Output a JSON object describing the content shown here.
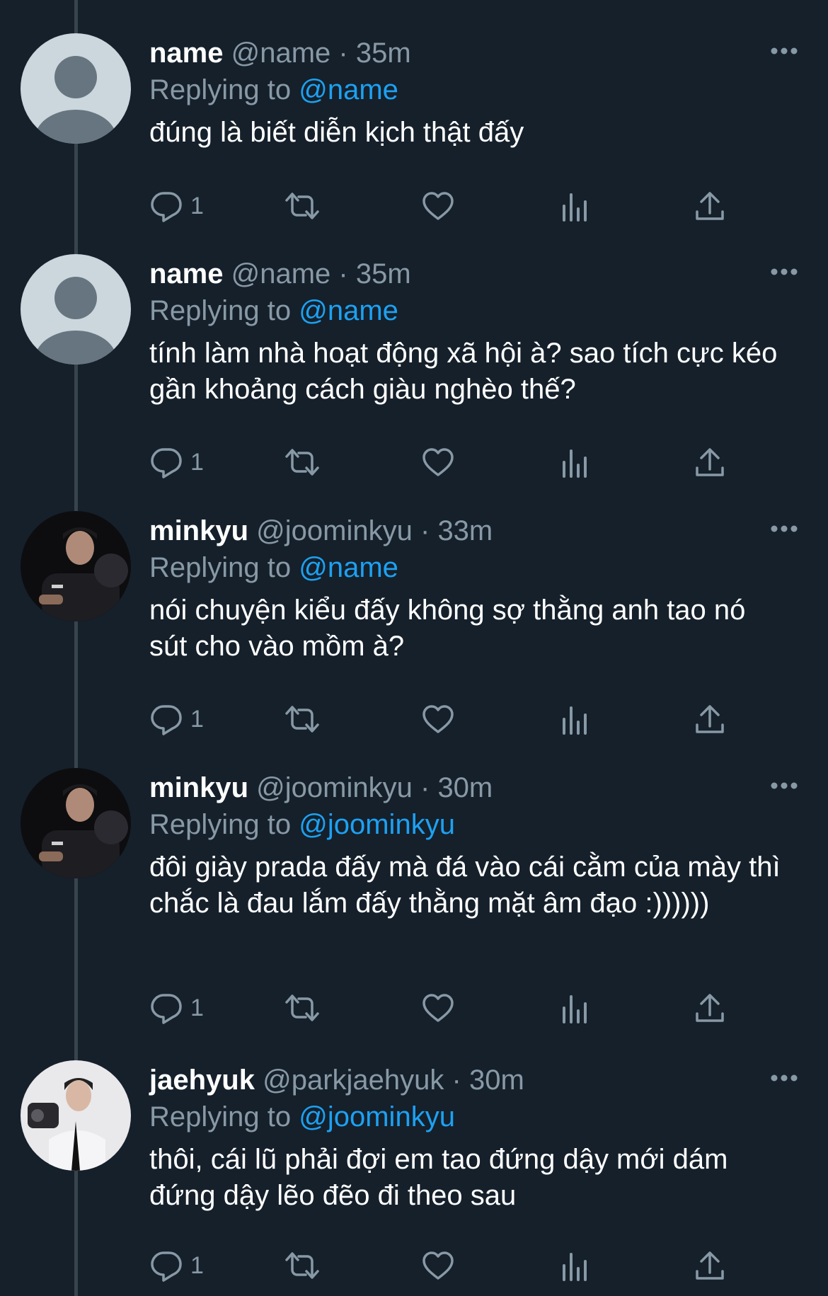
{
  "tweets": [
    {
      "username": "name",
      "handle": "@name",
      "dot": "·",
      "time": "35m",
      "replying_prefix": "Replying to",
      "replying_to": "@name",
      "text": "đúng là biết diễn kịch thật đấy",
      "reply_count": "1",
      "avatar": "default-avatar"
    },
    {
      "username": "name",
      "handle": "@name",
      "dot": "·",
      "time": "35m",
      "replying_prefix": "Replying to",
      "replying_to": "@name",
      "text": "tính làm nhà hoạt động xã hội à? sao tích cực kéo gần khoảng cách giàu nghèo thế?",
      "reply_count": "1",
      "avatar": "default-avatar"
    },
    {
      "username": "minkyu",
      "handle": "@joominkyu",
      "dot": "·",
      "time": "33m",
      "replying_prefix": "Replying to",
      "replying_to": "@name",
      "text": "nói chuyện kiểu đấy không sợ thằng anh tao nó sút cho vào mồm à?",
      "reply_count": "1",
      "avatar": "photo-avatar-dark"
    },
    {
      "username": "minkyu",
      "handle": "@joominkyu",
      "dot": "·",
      "time": "30m",
      "replying_prefix": "Replying to",
      "replying_to": "@joominkyu",
      "text": "đôi giày prada đấy mà đá vào cái cằm của mày thì chắc là đau lắm đấy thằng mặt âm đạo :))))))",
      "reply_count": "1",
      "avatar": "photo-avatar-dark"
    },
    {
      "username": "jaehyuk",
      "handle": "@parkjaehyuk",
      "dot": "·",
      "time": "30m",
      "replying_prefix": "Replying to",
      "replying_to": "@joominkyu",
      "text": "thôi, cái lũ phải đợi em tao đứng dậy mới dám đứng dậy lẽo đẽo đi theo sau",
      "reply_count": "1",
      "avatar": "photo-avatar-light"
    }
  ],
  "icons": [
    "reply-icon",
    "retweet-icon",
    "like-icon",
    "analytics-icon",
    "share-icon",
    "more-icon"
  ],
  "colors": {
    "background": "#15202b",
    "primary_text": "#ffffff",
    "secondary_text": "#8899a6",
    "link": "#1da1f2",
    "thread_line": "#38444d",
    "icon": "#8899a6"
  }
}
